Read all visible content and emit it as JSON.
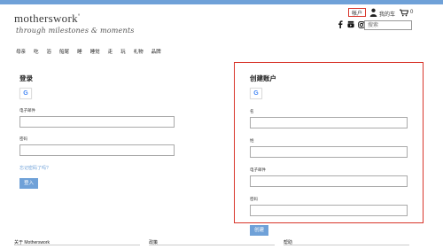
{
  "brand": {
    "name": "motherswork",
    "tagline": "through milestones & moments",
    "mark": "°"
  },
  "header": {
    "account_label": "帐户",
    "cart_label": "我的车",
    "cart_count": "0",
    "search_placeholder": "搜索",
    "icons": [
      "person-icon",
      "cart-icon",
      "facebook-icon",
      "youtube-icon",
      "instagram-icon"
    ]
  },
  "nav": {
    "items": [
      "母亲",
      "吃",
      "浴",
      "船尾",
      "睡",
      "睡觉",
      "走",
      "玩",
      "礼物",
      "品牌"
    ]
  },
  "login": {
    "title": "登录",
    "google_label": "G",
    "email_label": "电子邮件",
    "password_label": "密码",
    "forgot_label": "忘记密码了吗?",
    "submit_label": "登入"
  },
  "register": {
    "title": "创建账户",
    "google_label": "G",
    "first_name_label": "名",
    "last_name_label": "姓",
    "email_label": "电子邮件",
    "password_label": "密码",
    "submit_label": "创建"
  },
  "footer": {
    "col1": "关于 Motherswork",
    "col2": "政策",
    "col3": "帮助"
  },
  "colors": {
    "accent": "#6fa1d8",
    "highlight": "#d8352a",
    "google_blue": "#4285F4"
  }
}
